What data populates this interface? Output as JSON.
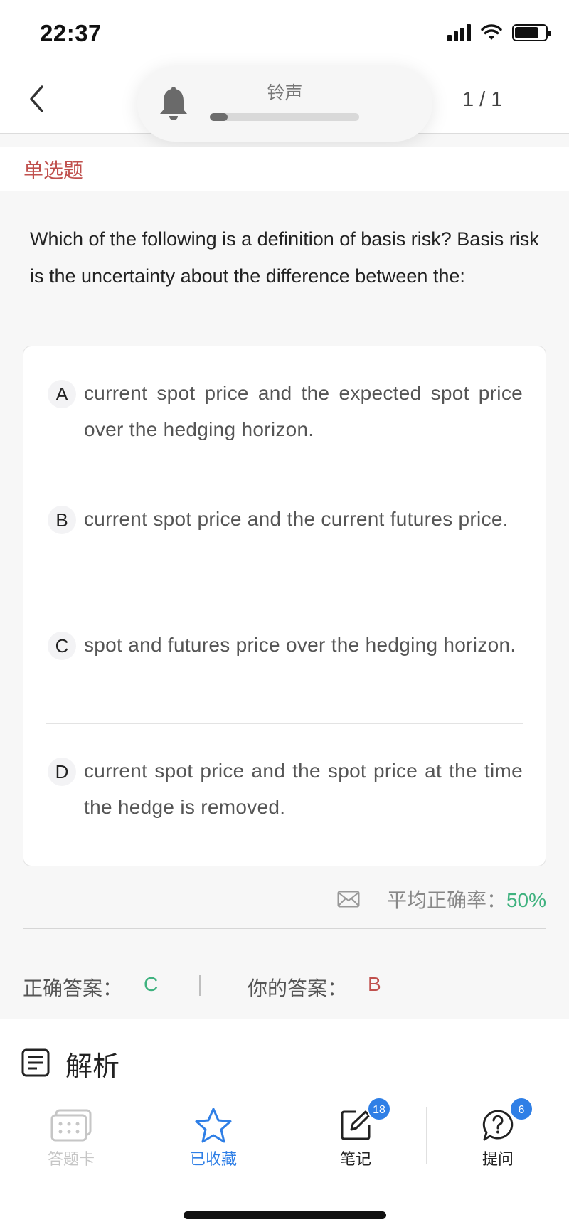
{
  "status_bar": {
    "time": "22:37"
  },
  "nav": {
    "counter": "1 / 1"
  },
  "ringer": {
    "label": "铃声",
    "level_percent": 12
  },
  "question_type": "单选题",
  "question": {
    "text": "Which of the following is a definition of basis risk? Basis risk is the uncertainty about the difference between the:",
    "options": [
      {
        "letter": "A",
        "text": "current spot price and the expected spot price over the hedging horizon."
      },
      {
        "letter": "B",
        "text": "current spot price and the current futures price."
      },
      {
        "letter": "C",
        "text": "spot and futures price over the hedging horizon."
      },
      {
        "letter": "D",
        "text": "current spot price and the spot price at the time the hedge is removed."
      }
    ]
  },
  "stats": {
    "label": "平均正确率：",
    "value": "50%"
  },
  "answers": {
    "correct_label": "正确答案：",
    "correct": "C",
    "yours_label": "你的答案：",
    "yours": "B"
  },
  "analysis": {
    "title": "解析"
  },
  "tabs": [
    {
      "label": "答题卡",
      "icon": "answer-card-icon"
    },
    {
      "label": "已收藏",
      "icon": "star-icon"
    },
    {
      "label": "笔记",
      "icon": "note-icon",
      "badge": "18"
    },
    {
      "label": "提问",
      "icon": "question-icon",
      "badge": "6"
    }
  ],
  "colors": {
    "accent_red": "#c0504d",
    "accent_green": "#3fb27f",
    "accent_blue": "#2f7fe6",
    "inactive_gray": "#c6c6c6"
  }
}
